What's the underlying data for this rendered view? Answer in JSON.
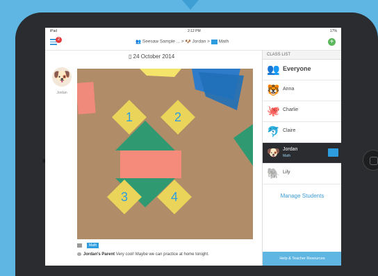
{
  "status": {
    "carrier": "iPad ",
    "time": "2:12 PM",
    "battery": "17%"
  },
  "nav": {
    "badge": "2",
    "crumb_class": "Seesaw Sample ...",
    "crumb_student": "Jordan",
    "crumb_folder": "Math",
    "sep": ">"
  },
  "post": {
    "date": "24 October 2014",
    "author": "Jordan",
    "folder_tag": "Math",
    "comment_author": "Jordan's Parent",
    "comment_text": "Very cool! Maybe we can practice at home tonight."
  },
  "class_list": {
    "header": "CLASS LIST",
    "students": [
      {
        "name": "Everyone",
        "icon": "people-icon"
      },
      {
        "name": "Anna",
        "icon": "tiger-icon"
      },
      {
        "name": "Charlie",
        "icon": "octopus-icon"
      },
      {
        "name": "Claire",
        "icon": "dolphin-icon"
      },
      {
        "name": "Jordan",
        "icon": "dog-icon",
        "sub": "Math",
        "selected": true
      },
      {
        "name": "Lily",
        "icon": "elephant-icon"
      }
    ],
    "manage": "Manage Students",
    "help": "Help & Teacher Resources"
  },
  "photo_labels": [
    "1",
    "2",
    "3",
    "4"
  ],
  "colors": {
    "accent": "#2d9de0",
    "background": "#5fb6e3",
    "selected_row": "#2a2c2f"
  }
}
